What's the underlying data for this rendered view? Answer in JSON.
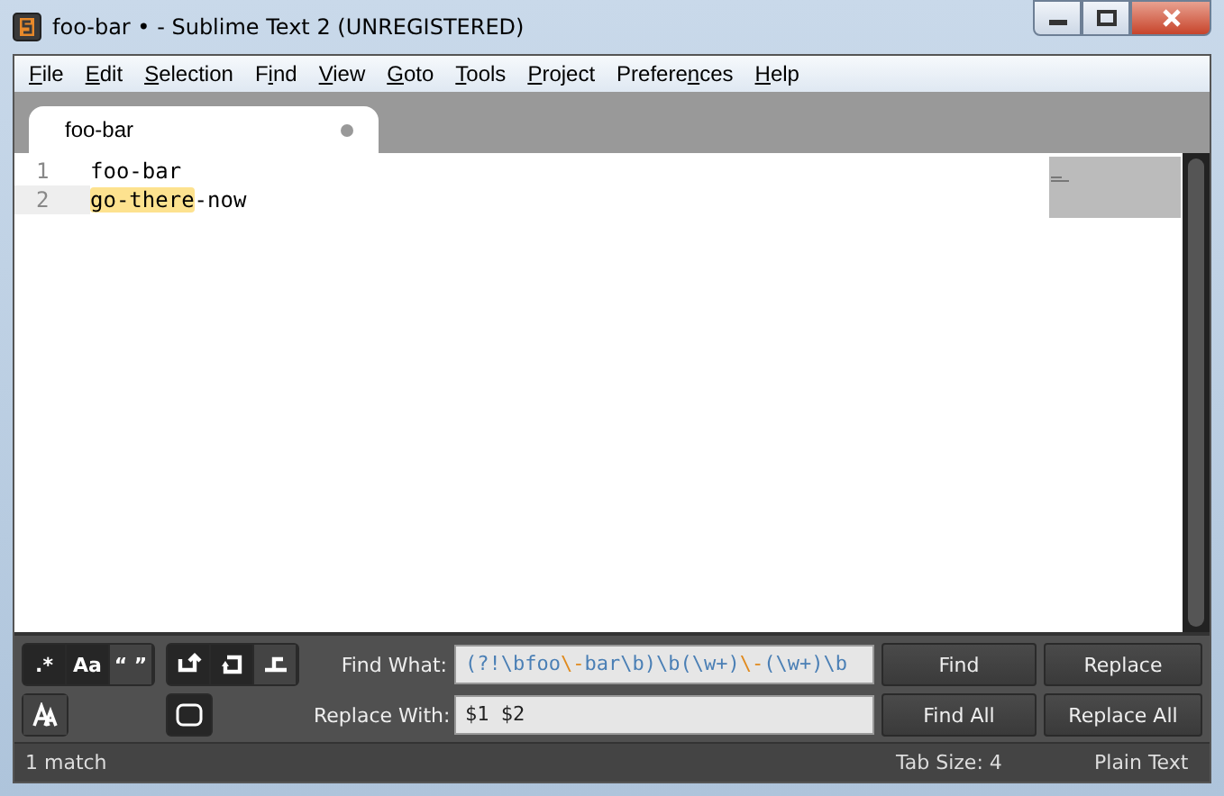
{
  "window": {
    "title": "foo-bar • - Sublime Text 2 (UNREGISTERED)"
  },
  "menu": [
    {
      "key": "F",
      "after": "ile"
    },
    {
      "key": "E",
      "after": "dit"
    },
    {
      "key": "S",
      "after": "election"
    },
    {
      "before": "F",
      "key": "i",
      "after": "nd"
    },
    {
      "key": "V",
      "after": "iew"
    },
    {
      "key": "G",
      "after": "oto"
    },
    {
      "key": "T",
      "after": "ools"
    },
    {
      "key": "P",
      "after": "roject"
    },
    {
      "before": "Prefere",
      "key": "n",
      "after": "ces"
    },
    {
      "key": "H",
      "after": "elp"
    }
  ],
  "tabs": [
    {
      "label": "foo-bar",
      "selected": true,
      "modified": true
    }
  ],
  "lines": [
    {
      "number": "1",
      "current": false,
      "segments": [
        {
          "text": "foo-bar",
          "highlight": false
        }
      ]
    },
    {
      "number": "2",
      "current": true,
      "segments": [
        {
          "text": "go-there",
          "highlight": true
        },
        {
          "text": "-now",
          "highlight": false
        }
      ]
    }
  ],
  "find_panel": {
    "toggles": [
      {
        "kind": "regex",
        "glyph": ".*",
        "on": true
      },
      {
        "kind": "case",
        "glyph": "Aa",
        "on": true
      },
      {
        "kind": "word",
        "glyph": "“ ”",
        "on": false
      },
      {
        "kind": "wrap",
        "on": true
      },
      {
        "kind": "selection",
        "on": true
      },
      {
        "kind": "highlight",
        "on": false
      }
    ],
    "row2_toggles": [
      {
        "kind": "preserve-case",
        "on": false
      },
      {
        "kind": "context",
        "on": true
      }
    ],
    "find_label": "Find What:",
    "find_segments": [
      {
        "text": "(?!\\bfoo",
        "kind": "regex"
      },
      {
        "text": "\\-",
        "kind": "escape"
      },
      {
        "text": "bar\\b)\\b(\\w+)",
        "kind": "regex"
      },
      {
        "text": "\\-",
        "kind": "escape"
      },
      {
        "text": "(\\w+)\\b",
        "kind": "regex"
      }
    ],
    "replace_label": "Replace With:",
    "replace_value": "$1 $2",
    "buttons": [
      [
        "Find",
        "Replace"
      ],
      [
        "Find All",
        "Replace All"
      ]
    ]
  },
  "status_bar": {
    "left": "1 match",
    "tab_size": "Tab Size: 4",
    "syntax": "Plain Text"
  }
}
